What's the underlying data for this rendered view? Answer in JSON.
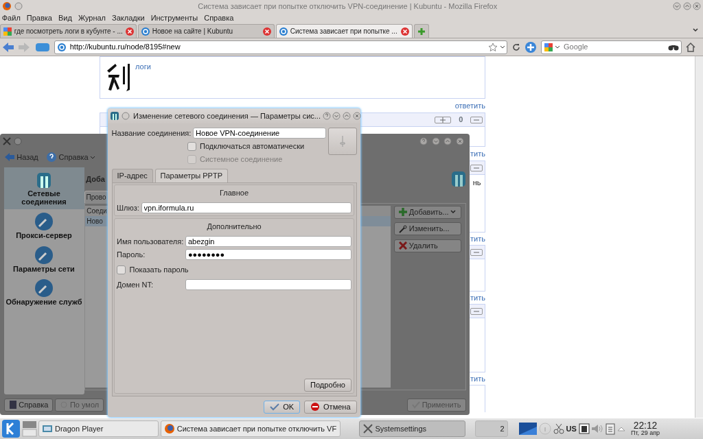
{
  "browser": {
    "title": "Система зависает при попытке отключить VPN-соединение | Kubuntu - Mozilla Firefox",
    "menu": [
      "Файл",
      "Правка",
      "Вид",
      "Журнал",
      "Закладки",
      "Инструменты",
      "Справка"
    ],
    "tabs": [
      {
        "label": "где посмотреть логи в кубунте - ...",
        "selected": false,
        "kind": "google"
      },
      {
        "label": "Новое на сайте | Kubuntu",
        "selected": false,
        "kind": "site"
      },
      {
        "label": "Система зависает при попытке ...",
        "selected": true,
        "kind": "site"
      }
    ],
    "url": "http://kubuntu.ru/node/8195#new",
    "search": {
      "placeholder": "Google"
    }
  },
  "page": {
    "comment_link": "логи",
    "reply_link": "ответить",
    "vote_count": "0",
    "fragment": "нь",
    "reply_fragments": [
      "тить",
      "тить",
      "тить",
      "тить"
    ]
  },
  "settings_window": {
    "toolbar": [
      "Назад",
      "Справка"
    ],
    "sidebar": [
      {
        "label": "Сетевые соединения",
        "selected": true
      },
      {
        "label": "Прокси-сервер",
        "selected": false
      },
      {
        "label": "Параметры сети",
        "selected": false
      },
      {
        "label": "Обнаружение служб",
        "selected": false
      }
    ],
    "heading": "Доба",
    "tab": "Прово",
    "list_header": "Соеди",
    "rows": [
      {
        "label": "Ново",
        "selected": true
      }
    ],
    "buttons": [
      {
        "label": "Добавить...",
        "kind": "add"
      },
      {
        "label": "Изменить...",
        "kind": "edit"
      },
      {
        "label": "Удалить",
        "kind": "delete"
      }
    ],
    "footer": [
      {
        "label": "Справка",
        "disabled": false
      },
      {
        "label": "По умол",
        "disabled": true
      },
      {
        "label": "Применить",
        "disabled": true
      }
    ]
  },
  "dialog": {
    "title": "Изменение сетевого соединения — Параметры сис...",
    "name_label": "Название соединения:",
    "name_value": "Новое VPN-соединение",
    "options": [
      {
        "label": "Подключаться автоматически",
        "checked": false,
        "disabled": false
      },
      {
        "label": "Системное соединение",
        "checked": false,
        "disabled": true
      }
    ],
    "tabs": [
      {
        "label": "IP-адрес",
        "selected": false
      },
      {
        "label": "Параметры PPTP",
        "selected": true
      }
    ],
    "sections": [
      {
        "title": "Главное",
        "items": [
          {
            "kind": "field",
            "label": "Шлюз:",
            "value": "vpn.iformula.ru"
          }
        ]
      },
      {
        "title": "Дополнительно",
        "items": [
          {
            "kind": "field",
            "label": "Имя пользователя:",
            "value": "abezgin"
          },
          {
            "kind": "field",
            "label": "Пароль:",
            "value": "●●●●●●●●"
          },
          {
            "kind": "checkbox",
            "label": "Показать пароль",
            "checked": false
          },
          {
            "kind": "field",
            "label": "Домен NT:",
            "value": ""
          }
        ]
      }
    ],
    "advanced_button": "Подробно",
    "buttons": [
      {
        "label": "OK",
        "kind": "ok"
      },
      {
        "label": "Отмена",
        "kind": "cancel"
      }
    ]
  },
  "taskbar": {
    "tasks": [
      {
        "label": "Dragon Player",
        "selected": false,
        "kind": "player"
      },
      {
        "label": "Система зависает при попытке отключить VF",
        "selected": false,
        "kind": "firefox"
      },
      {
        "label": "Systemsettings",
        "selected": true,
        "kind": "settings"
      }
    ],
    "desktop": "2",
    "layout": "US",
    "time": "22:12",
    "date": "Пт, 29 апр"
  }
}
